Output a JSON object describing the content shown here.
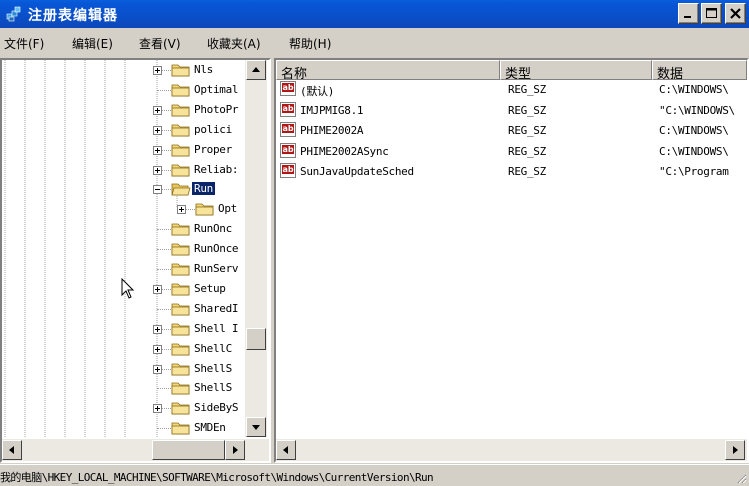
{
  "window": {
    "title": "注册表编辑器"
  },
  "menu": [
    "文件(F)",
    "编辑(E)",
    "查看(V)",
    "收藏夹(A)",
    "帮助(H)"
  ],
  "tree": {
    "nodes": [
      {
        "label": "Nls",
        "expander": "plus"
      },
      {
        "label": "Optimal",
        "expander": "none"
      },
      {
        "label": "PhotoPr",
        "expander": "plus"
      },
      {
        "label": "polici",
        "expander": "plus"
      },
      {
        "label": "Proper",
        "expander": "plus"
      },
      {
        "label": "Reliab:",
        "expander": "plus"
      },
      {
        "label": "Run",
        "expander": "minus",
        "selected": true
      },
      {
        "label": "Opt",
        "expander": "plus",
        "child": true
      },
      {
        "label": "RunOnc",
        "expander": "none"
      },
      {
        "label": "RunOnce",
        "expander": "none"
      },
      {
        "label": "RunServ",
        "expander": "none"
      },
      {
        "label": "Setup",
        "expander": "plus"
      },
      {
        "label": "SharedI",
        "expander": "none"
      },
      {
        "label": "Shell I",
        "expander": "plus"
      },
      {
        "label": "ShellC",
        "expander": "plus"
      },
      {
        "label": "ShellS",
        "expander": "plus"
      },
      {
        "label": "ShellS",
        "expander": "none"
      },
      {
        "label": "SideByS",
        "expander": "plus"
      },
      {
        "label": "SMDEn",
        "expander": "none"
      }
    ]
  },
  "list": {
    "columns": [
      "名称",
      "类型",
      "数据"
    ],
    "rows": [
      {
        "name": "(默认)",
        "type": "REG_SZ",
        "data": "C:\\WINDOWS\\"
      },
      {
        "name": "IMJPMIG8.1",
        "type": "REG_SZ",
        "data": "\"C:\\WINDOWS\\"
      },
      {
        "name": "PHIME2002A",
        "type": "REG_SZ",
        "data": "C:\\WINDOWS\\"
      },
      {
        "name": "PHIME2002ASync",
        "type": "REG_SZ",
        "data": "C:\\WINDOWS\\"
      },
      {
        "name": "SunJavaUpdateSched",
        "type": "REG_SZ",
        "data": "\"C:\\Program"
      }
    ]
  },
  "status": {
    "path": "我的电脑\\HKEY_LOCAL_MACHINE\\SOFTWARE\\Microsoft\\Windows\\CurrentVersion\\Run"
  },
  "colors": {
    "titlebar": "#0a5edc",
    "selection": "#0a246a",
    "chrome": "#d4d0c8"
  }
}
